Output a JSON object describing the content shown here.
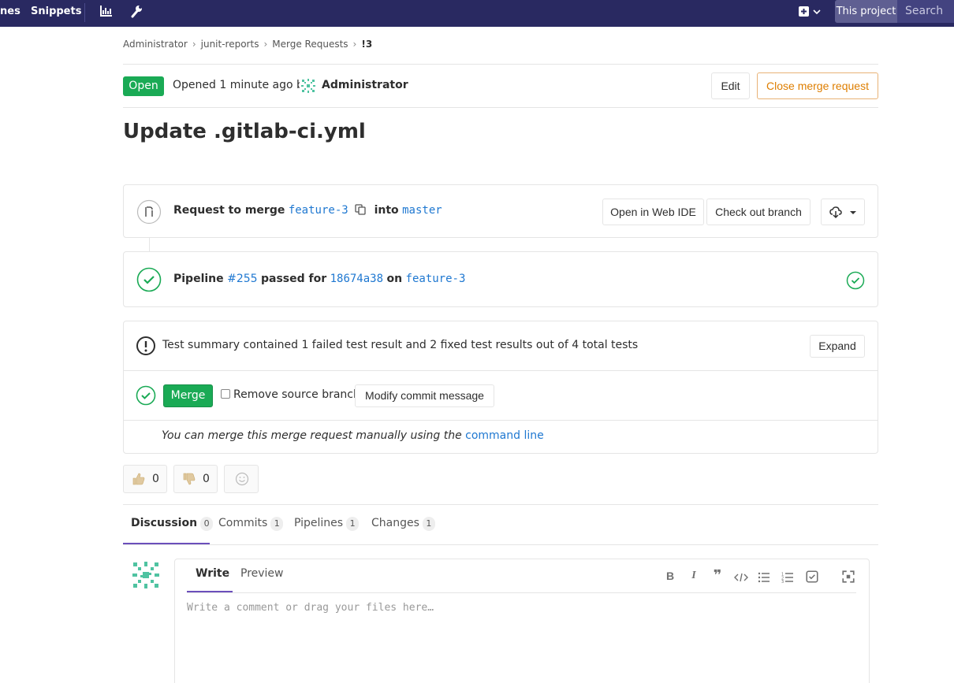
{
  "navbar": {
    "link_partial": "nes",
    "link_snippets": "Snippets",
    "scope_label": "This project",
    "search_placeholder": "Search"
  },
  "breadcrumb": [
    "Administrator",
    "junit-reports",
    "Merge Requests",
    "!3"
  ],
  "header": {
    "status_badge": "Open",
    "opened_text": "Opened 1 minute ago by",
    "author": "Administrator",
    "edit_label": "Edit",
    "close_label": "Close merge request"
  },
  "title": "Update .gitlab-ci.yml",
  "merge_widget": {
    "request_label": "Request to merge",
    "source_branch": "feature-3",
    "into_label": "into",
    "target_branch": "master",
    "open_web_ide": "Open in Web IDE",
    "checkout_branch": "Check out branch"
  },
  "pipeline": {
    "label": "Pipeline",
    "id": "#255",
    "passed_label": "passed for",
    "commit": "18674a38",
    "on_label": "on",
    "branch": "feature-3"
  },
  "test_summary": {
    "text": "Test summary contained 1 failed test result and 2 fixed test results out of 4 total tests",
    "expand_label": "Expand"
  },
  "merge_actions": {
    "merge_label": "Merge",
    "remove_source_label": "Remove source branch",
    "modify_commit_label": "Modify commit message",
    "manual_text": "You can merge this merge request manually using the",
    "command_line_link": "command line"
  },
  "awards": {
    "thumbs_up_count": "0",
    "thumbs_down_count": "0"
  },
  "tabs": [
    {
      "label": "Discussion",
      "count": "0"
    },
    {
      "label": "Commits",
      "count": "1"
    },
    {
      "label": "Pipelines",
      "count": "1"
    },
    {
      "label": "Changes",
      "count": "1"
    }
  ],
  "comment": {
    "write_tab": "Write",
    "preview_tab": "Preview",
    "placeholder": "Write a comment or drag your files here…"
  },
  "colors": {
    "navbar": "#292961",
    "success": "#1aaa55",
    "link": "#1f78d1",
    "warning": "#de7e00",
    "tab_accent": "#6b4fbb"
  }
}
